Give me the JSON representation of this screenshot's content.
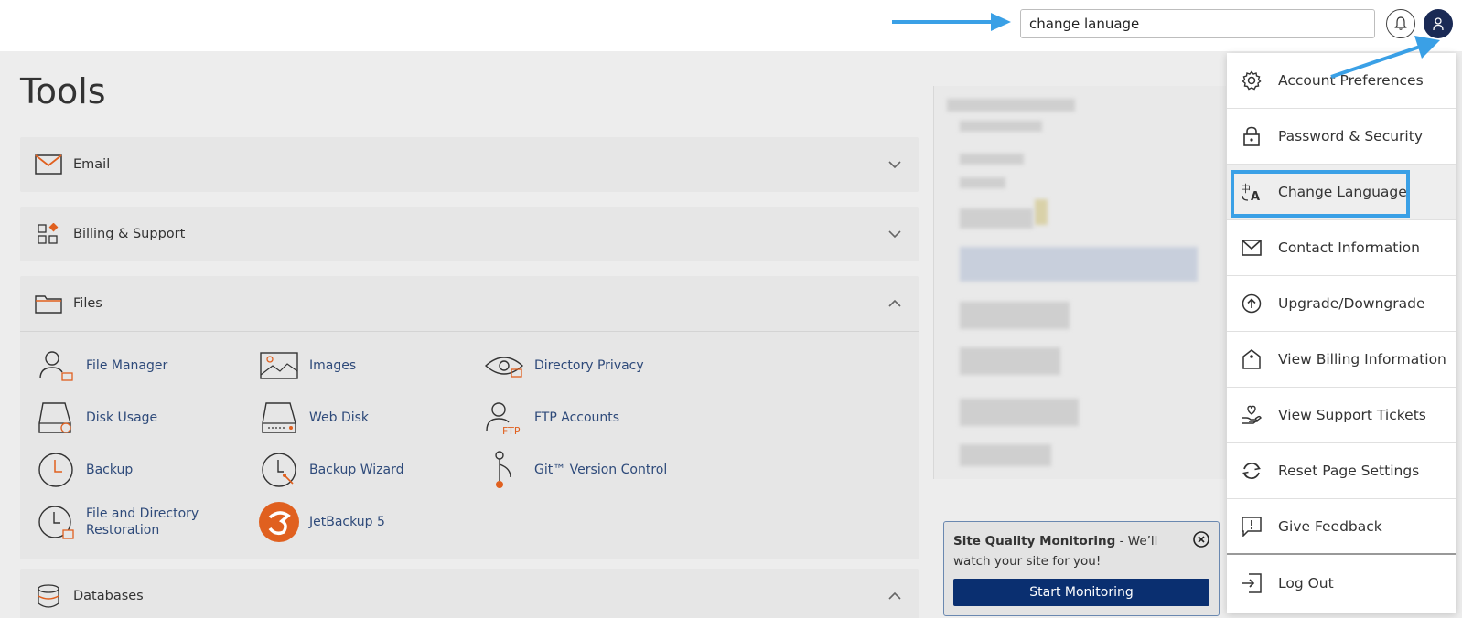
{
  "header": {
    "search_value": "change lanuage"
  },
  "page": {
    "title": "Tools"
  },
  "sections": {
    "email": "Email",
    "billing": "Billing & Support",
    "files": "Files",
    "databases": "Databases"
  },
  "files_tools": [
    "File Manager",
    "Images",
    "Directory Privacy",
    "Disk Usage",
    "Web Disk",
    "FTP Accounts",
    "Backup",
    "Backup Wizard",
    "Git™ Version Control",
    "File and Directory Restoration",
    "JetBackup 5"
  ],
  "site_quality": {
    "title": "Site Quality Monitoring",
    "text": " - We’ll watch your site for you!",
    "button": "Start Monitoring"
  },
  "user_menu": {
    "items": [
      {
        "label": "Account Preferences",
        "icon": "gear-icon"
      },
      {
        "label": "Password & Security",
        "icon": "lock-icon"
      },
      {
        "label": "Change Language",
        "icon": "translate-icon"
      },
      {
        "label": "Contact Information",
        "icon": "envelope-icon"
      },
      {
        "label": "Upgrade/Downgrade",
        "icon": "upgrade-icon"
      },
      {
        "label": "View Billing Information",
        "icon": "billing-tag-icon"
      },
      {
        "label": "View Support Tickets",
        "icon": "support-hand-icon"
      },
      {
        "label": "Reset Page Settings",
        "icon": "reset-icon"
      },
      {
        "label": "Give Feedback",
        "icon": "feedback-icon"
      },
      {
        "label": "Log Out",
        "icon": "logout-icon"
      }
    ]
  },
  "colors": {
    "accent_blue": "#3aa0e6",
    "navy": "#1a2a55",
    "button_navy": "#0a2f70",
    "link_blue": "#2e4a7a"
  }
}
